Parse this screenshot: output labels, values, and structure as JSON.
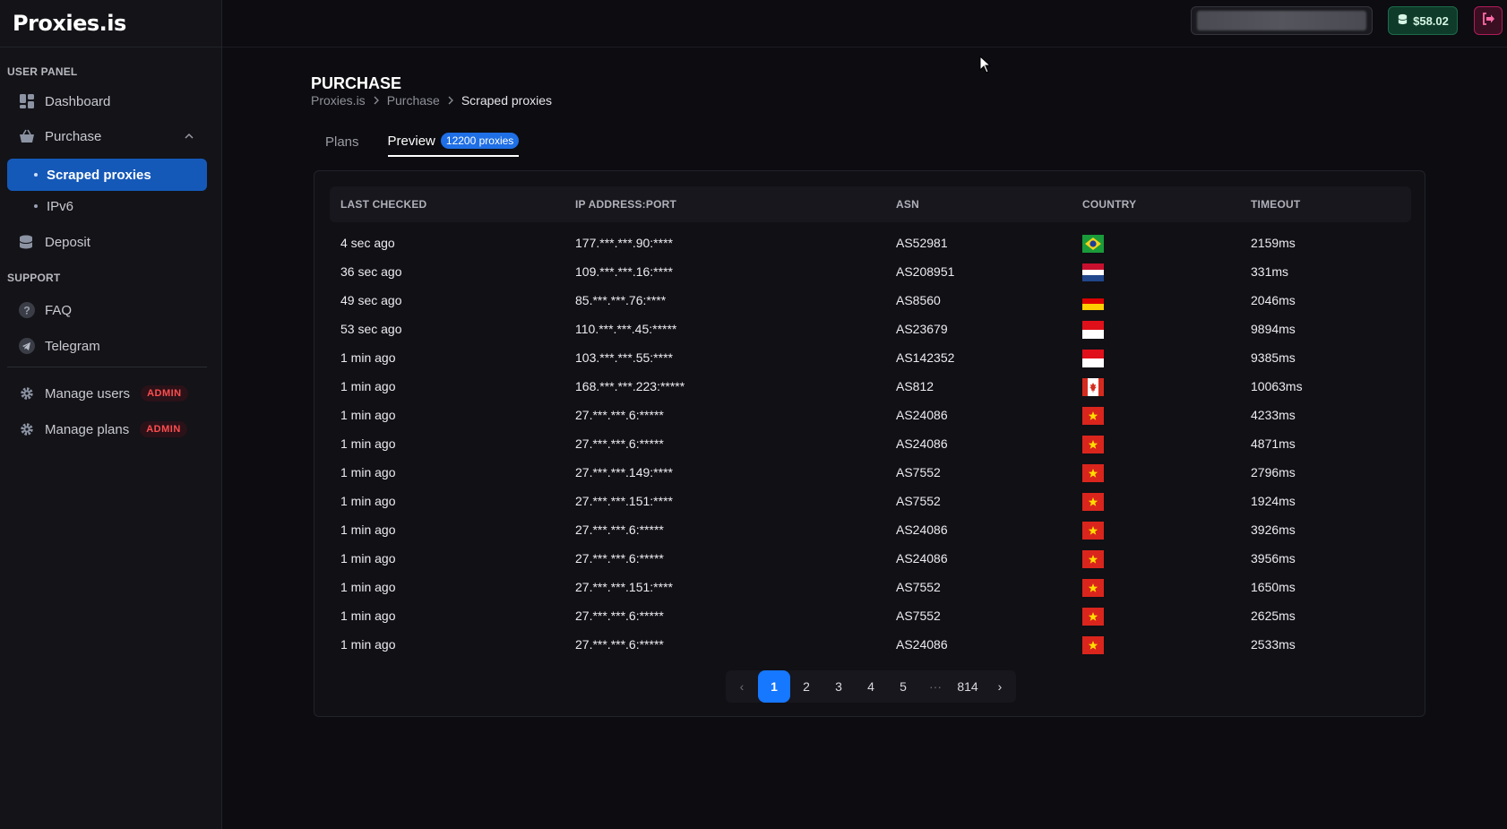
{
  "brand": {
    "logo": "Proxies.is"
  },
  "sidebar": {
    "section_user": "USER PANEL",
    "section_support": "SUPPORT",
    "items": {
      "dashboard": "Dashboard",
      "purchase": "Purchase",
      "scraped": "Scraped proxies",
      "ipv6": "IPv6",
      "deposit": "Deposit",
      "faq": "FAQ",
      "telegram": "Telegram",
      "manage_users": "Manage users",
      "manage_plans": "Manage plans"
    },
    "admin_badge": "ADMIN"
  },
  "header": {
    "balance": "$58.02"
  },
  "page": {
    "title": "PURCHASE",
    "breadcrumb": [
      "Proxies.is",
      "Purchase",
      "Scraped proxies"
    ],
    "tabs": {
      "plans": "Plans",
      "preview": "Preview",
      "preview_badge": "12200 proxies"
    }
  },
  "table": {
    "headers": [
      "LAST CHECKED",
      "IP ADDRESS:PORT",
      "ASN",
      "COUNTRY",
      "TIMEOUT"
    ],
    "rows": [
      {
        "checked": "4 sec ago",
        "ip": "177.***.***.90:****",
        "asn": "AS52981",
        "country": "brazil-flag",
        "timeout": "2159ms"
      },
      {
        "checked": "36 sec ago",
        "ip": "109.***.***.16:****",
        "asn": "AS208951",
        "country": "netherlands-flag",
        "timeout": "331ms"
      },
      {
        "checked": "49 sec ago",
        "ip": "85.***.***.76:****",
        "asn": "AS8560",
        "country": "germany-flag",
        "timeout": "2046ms"
      },
      {
        "checked": "53 sec ago",
        "ip": "110.***.***.45:*****",
        "asn": "AS23679",
        "country": "indonesia-flag",
        "timeout": "9894ms"
      },
      {
        "checked": "1 min ago",
        "ip": "103.***.***.55:****",
        "asn": "AS142352",
        "country": "indonesia-flag",
        "timeout": "9385ms"
      },
      {
        "checked": "1 min ago",
        "ip": "168.***.***.223:*****",
        "asn": "AS812",
        "country": "canada-flag",
        "timeout": "10063ms"
      },
      {
        "checked": "1 min ago",
        "ip": "27.***.***.6:*****",
        "asn": "AS24086",
        "country": "vietnam-flag",
        "timeout": "4233ms"
      },
      {
        "checked": "1 min ago",
        "ip": "27.***.***.6:*****",
        "asn": "AS24086",
        "country": "vietnam-flag",
        "timeout": "4871ms"
      },
      {
        "checked": "1 min ago",
        "ip": "27.***.***.149:****",
        "asn": "AS7552",
        "country": "vietnam-flag",
        "timeout": "2796ms"
      },
      {
        "checked": "1 min ago",
        "ip": "27.***.***.151:****",
        "asn": "AS7552",
        "country": "vietnam-flag",
        "timeout": "1924ms"
      },
      {
        "checked": "1 min ago",
        "ip": "27.***.***.6:*****",
        "asn": "AS24086",
        "country": "vietnam-flag",
        "timeout": "3926ms"
      },
      {
        "checked": "1 min ago",
        "ip": "27.***.***.6:*****",
        "asn": "AS24086",
        "country": "vietnam-flag",
        "timeout": "3956ms"
      },
      {
        "checked": "1 min ago",
        "ip": "27.***.***.151:****",
        "asn": "AS7552",
        "country": "vietnam-flag",
        "timeout": "1650ms"
      },
      {
        "checked": "1 min ago",
        "ip": "27.***.***.6:*****",
        "asn": "AS7552",
        "country": "vietnam-flag",
        "timeout": "2625ms"
      },
      {
        "checked": "1 min ago",
        "ip": "27.***.***.6:*****",
        "asn": "AS24086",
        "country": "vietnam-flag",
        "timeout": "2533ms"
      }
    ]
  },
  "pagination": {
    "prev": "‹",
    "pages": [
      "1",
      "2",
      "3",
      "4",
      "5"
    ],
    "ellipsis": "···",
    "last": "814",
    "next": "›",
    "current": "1"
  },
  "colors": {
    "accent": "#1677ff",
    "active_nav": "#1559b8",
    "admin": "#ff4d4f",
    "balance": "#0f3b2a",
    "logout": "#b01b5c"
  }
}
